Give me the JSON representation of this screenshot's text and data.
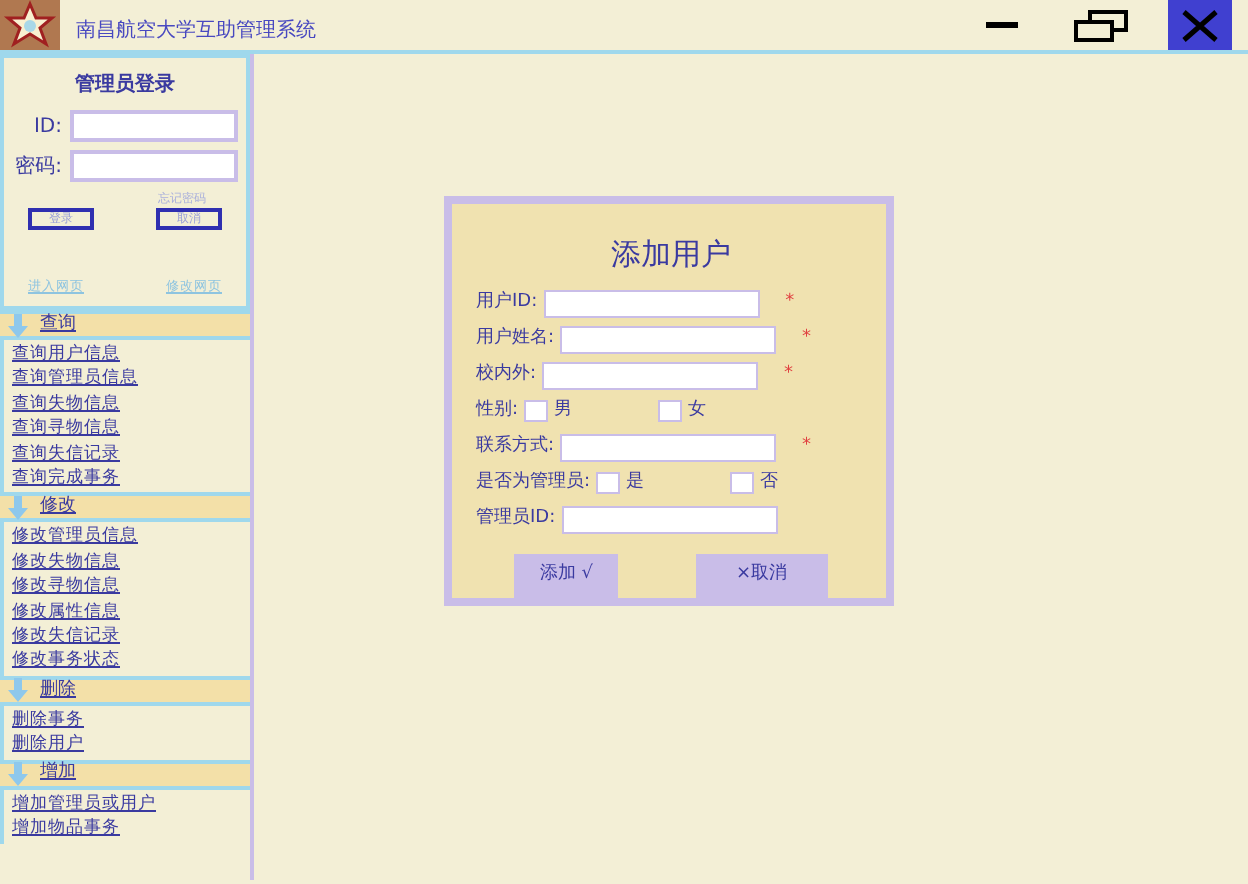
{
  "window": {
    "title": "南昌航空大学互助管理系统"
  },
  "login": {
    "title": "管理员登录",
    "fields": [
      {
        "label": "ID:"
      },
      {
        "label": "密码:"
      }
    ],
    "forgot": "忘记密码",
    "buttons": [
      "登录",
      "取消"
    ],
    "links": [
      "进入网页",
      "修改网页"
    ]
  },
  "sidebar": [
    {
      "title": "查询",
      "items": [
        "查询用户信息",
        "查询管理员信息",
        "查询失物信息",
        "查询寻物信息",
        "查询失信记录",
        "查询完成事务"
      ]
    },
    {
      "title": "修改",
      "items": [
        "修改管理员信息",
        "修改失物信息",
        "修改寻物信息",
        "修改属性信息",
        "修改失信记录",
        "修改事务状态"
      ]
    },
    {
      "title": "删除",
      "items": [
        "删除事务",
        "删除用户"
      ]
    },
    {
      "title": "增加",
      "items": [
        "增加管理员或用户",
        "增加物品事务"
      ]
    }
  ],
  "form": {
    "title": "添加用户",
    "rows": [
      {
        "kind": "text",
        "label": "用户ID:",
        "mark": "*"
      },
      {
        "kind": "text",
        "label": "用户姓名:",
        "mark": "*"
      },
      {
        "kind": "text",
        "label": "校内外:",
        "mark": "*"
      },
      {
        "kind": "choice",
        "label": "性别:",
        "options": [
          {
            "label": "男",
            "checked": false
          },
          {
            "label": "女",
            "checked": false
          }
        ]
      },
      {
        "kind": "text",
        "label": "联系方式:",
        "mark": "*"
      },
      {
        "kind": "choice",
        "label": "是否为管理员:",
        "options": [
          {
            "label": "是",
            "checked": false
          },
          {
            "label": "否",
            "checked": false
          }
        ]
      },
      {
        "kind": "text",
        "label": "管理员ID:"
      }
    ],
    "buttons": [
      "添加 √",
      "×取消"
    ]
  }
}
